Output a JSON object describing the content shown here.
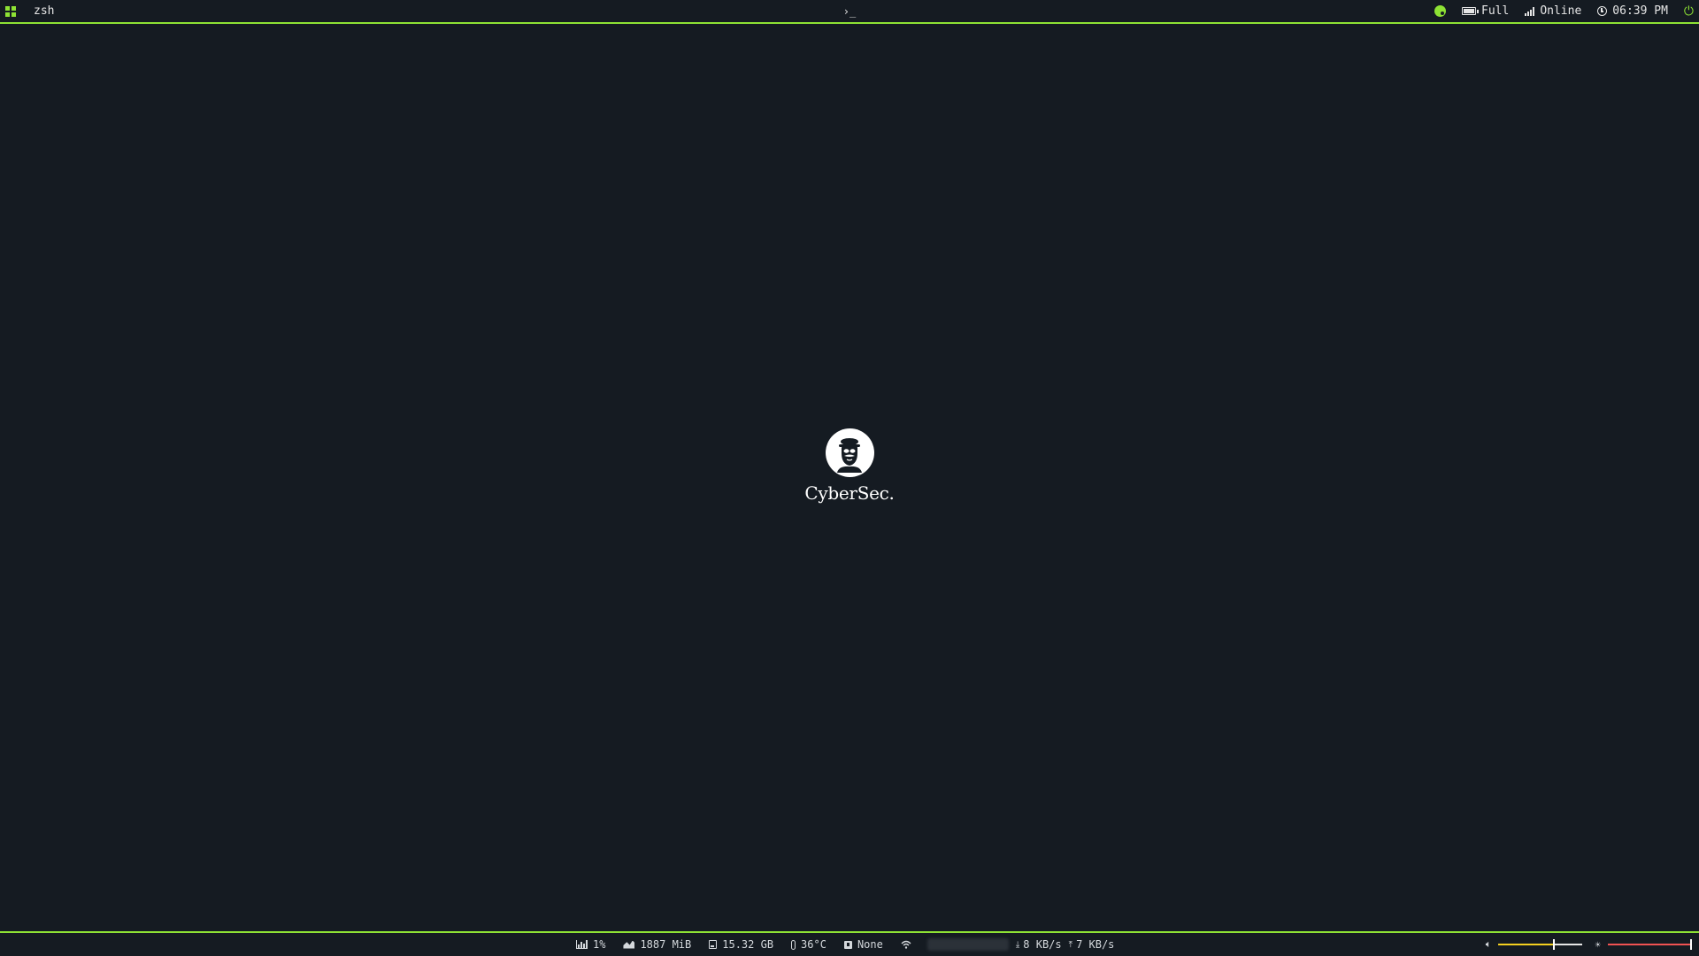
{
  "topbar": {
    "menu_icon": "app-grid-icon",
    "window_title": "zsh",
    "center_glyph": "›_",
    "palette_icon": "palette-icon",
    "battery": {
      "icon": "battery-icon",
      "label": "Full"
    },
    "network": {
      "icon": "signal-icon",
      "label": "Online"
    },
    "clock": {
      "icon": "clock-icon",
      "label": "06:39 PM"
    },
    "power_icon": "power-icon"
  },
  "center": {
    "logo_icon": "hacker-mask-icon",
    "logo_text": "CyberSec."
  },
  "bottombar": {
    "cpu": {
      "icon": "chart-icon",
      "value": "1%"
    },
    "memory": {
      "icon": "area-chart-icon",
      "value": "1887 MiB"
    },
    "disk": {
      "icon": "disk-icon",
      "value": "15.32 GB"
    },
    "temperature": {
      "icon": "thermometer-icon",
      "value": "36°C"
    },
    "bluetooth": {
      "icon": "device-icon",
      "value": "None"
    },
    "wifi": {
      "icon": "wifi-icon"
    },
    "download": {
      "icon": "download-arrow-icon",
      "value": "8 KB/s"
    },
    "upload": {
      "icon": "upload-arrow-icon",
      "value": "7 KB/s"
    },
    "volume": {
      "icon": "volume-icon",
      "level": 0.65,
      "color": "#f5d020"
    },
    "brightness": {
      "icon": "brightness-icon",
      "level": 1.0,
      "color": "#f05252"
    }
  },
  "colors": {
    "accent": "#8ee234",
    "background": "#151b22"
  }
}
